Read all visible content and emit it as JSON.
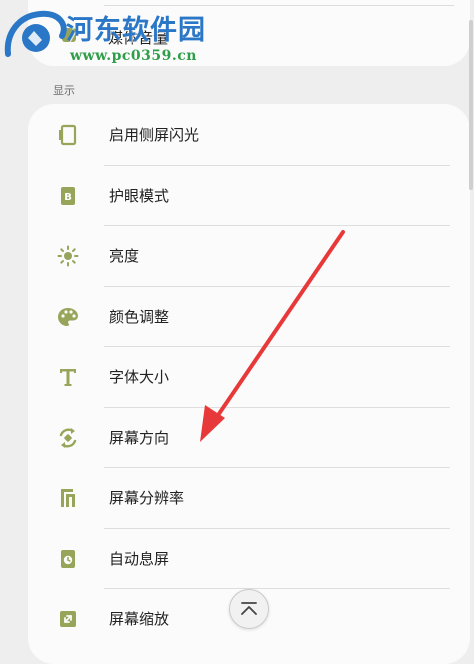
{
  "watermark": {
    "title": "河东软件园",
    "url": "www.pc0359.cn"
  },
  "top_item": {
    "label": "媒体音量"
  },
  "section": {
    "header": "显示"
  },
  "menu": [
    {
      "label": "启用侧屏闪光",
      "icon": "edge-flash-icon"
    },
    {
      "label": "护眼模式",
      "icon": "eye-comfort-icon"
    },
    {
      "label": "亮度",
      "icon": "brightness-icon"
    },
    {
      "label": "颜色调整",
      "icon": "palette-icon"
    },
    {
      "label": "字体大小",
      "icon": "font-size-icon"
    },
    {
      "label": "屏幕方向",
      "icon": "rotate-icon"
    },
    {
      "label": "屏幕分辨率",
      "icon": "resolution-icon"
    },
    {
      "label": "自动息屏",
      "icon": "screen-timeout-icon"
    },
    {
      "label": "屏幕缩放",
      "icon": "screen-zoom-icon"
    }
  ],
  "colors": {
    "icon": "#97a55a",
    "annotation_arrow": "#e8393a",
    "watermark_title": "#2b77c7",
    "watermark_url": "#2f9e49"
  },
  "scroll_top_button": {
    "icon": "chevron-up-icon"
  }
}
